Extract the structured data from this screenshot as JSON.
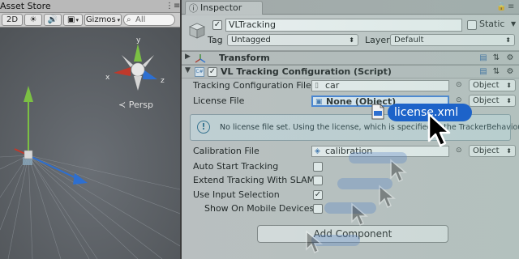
{
  "scene": {
    "tab_title": "Asset Store",
    "menu": "⋮≡",
    "toolbar": {
      "button_2d": "2D",
      "gizmos_label": "Gizmos",
      "search_placeholder": "All"
    },
    "gizmo_axes": {
      "x": "x",
      "y": "y",
      "z": "z"
    },
    "persp_label": "Persp"
  },
  "inspector": {
    "tab_title": "Inspector",
    "gameobject": {
      "name": "VLTracking",
      "active_checked": true,
      "static_label": "Static",
      "static_checked": false,
      "tag_label": "Tag",
      "tag_value": "Untagged",
      "layer_label": "Layer",
      "layer_value": "Default"
    },
    "components": {
      "transform": {
        "title": "Transform"
      },
      "vl_config": {
        "title": "VL Tracking Configuration (Script)",
        "fields": {
          "tracking_config_label": "Tracking Configuration File",
          "tracking_config_value": "car",
          "tracking_config_type": "Object",
          "license_label": "License File",
          "license_value": "None (Object)",
          "license_type": "Object",
          "help_message": "No license file set. Using the license, which is specified in the TrackerBehaviour.",
          "calibration_label": "Calibration File",
          "calibration_value": "calibration",
          "calibration_type": "Object",
          "auto_start_label": "Auto Start Tracking",
          "auto_start_checked": false,
          "extend_slam_label": "Extend Tracking With SLAM",
          "extend_slam_checked": false,
          "use_input_label": "Use Input Selection",
          "use_input_checked": true,
          "show_mobile_label": "Show On Mobile Devices",
          "show_mobile_checked": false
        }
      }
    },
    "add_component_label": "Add Component"
  },
  "drag": {
    "file_name": "license.xml"
  },
  "colors": {
    "accent_blue": "#1d63c9",
    "scene_bg": "#5a5e63",
    "axis_x": "#c0392b",
    "axis_y": "#7bc043",
    "axis_z": "#2d6fd1"
  }
}
